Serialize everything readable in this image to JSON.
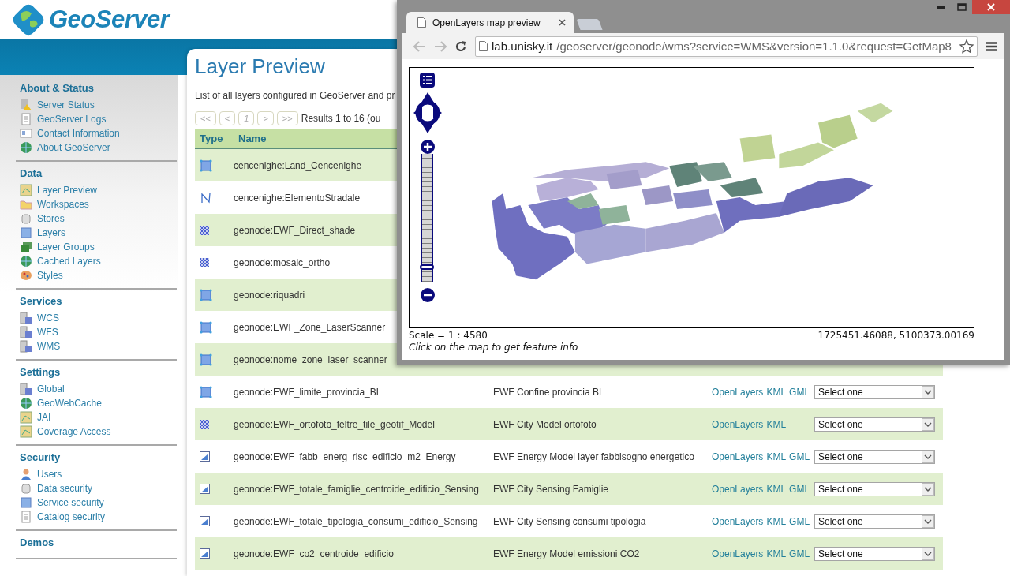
{
  "logo": {
    "text": "GeoServer"
  },
  "sidebar": {
    "sections": [
      {
        "title": "About & Status",
        "items": [
          "Server Status",
          "GeoServer Logs",
          "Contact Information",
          "About GeoServer"
        ]
      },
      {
        "title": "Data",
        "items": [
          "Layer Preview",
          "Workspaces",
          "Stores",
          "Layers",
          "Layer Groups",
          "Cached Layers",
          "Styles"
        ]
      },
      {
        "title": "Services",
        "items": [
          "WCS",
          "WFS",
          "WMS"
        ]
      },
      {
        "title": "Settings",
        "items": [
          "Global",
          "GeoWebCache",
          "JAI",
          "Coverage Access"
        ]
      },
      {
        "title": "Security",
        "items": [
          "Users",
          "Data security",
          "Service security",
          "Catalog security"
        ]
      },
      {
        "title": "Demos"
      }
    ]
  },
  "content": {
    "title": "Layer Preview",
    "description": "List of all layers configured in GeoServer and pr",
    "pager": {
      "buttons": [
        {
          "label": "<<",
          "kind": "nav"
        },
        {
          "label": "<",
          "kind": "nav"
        },
        {
          "label": "1",
          "kind": "page"
        },
        {
          "label": ">",
          "kind": "nav"
        },
        {
          "label": ">>",
          "kind": "nav"
        }
      ],
      "results": "Results 1 to 16 (ou"
    },
    "table": {
      "columns": [
        "Type",
        "Name"
      ],
      "rows": [
        {
          "kind": "polygon",
          "name": "cencenighe:Land_Cencenighe"
        },
        {
          "kind": "line",
          "name": "cencenighe:ElementoStradale"
        },
        {
          "kind": "raster",
          "name": "geonode:EWF_Direct_shade"
        },
        {
          "kind": "raster",
          "name": "geonode:mosaic_ortho"
        },
        {
          "kind": "polygon",
          "name": "geonode:riquadri"
        },
        {
          "kind": "polygon",
          "name": "geonode:EWF_Zone_LaserScanner"
        },
        {
          "kind": "polygon",
          "name": "geonode:nome_zone_laser_scanner"
        },
        {
          "kind": "polygon",
          "name": "geonode:EWF_limite_provincia_BL",
          "title": "EWF Confine provincia BL",
          "formats": [
            "OpenLayers",
            "KML",
            "GML"
          ],
          "select": "Select one"
        },
        {
          "kind": "raster",
          "name": "geonode:EWF_ortofoto_feltre_tile_geotif_Model",
          "title": "EWF City Model ortofoto",
          "formats": [
            "OpenLayers",
            "KML"
          ],
          "select": "Select one"
        },
        {
          "kind": "other",
          "name": "geonode:EWF_fabb_energ_risc_edificio_m2_Energy",
          "title": "EWF Energy Model layer fabbisogno energetico",
          "formats": [
            "OpenLayers",
            "KML",
            "GML"
          ],
          "select": "Select one"
        },
        {
          "kind": "other",
          "name": "geonode:EWF_totale_famiglie_centroide_edificio_Sensing",
          "title": "EWF City Sensing Famiglie",
          "formats": [
            "OpenLayers",
            "KML",
            "GML"
          ],
          "select": "Select one"
        },
        {
          "kind": "other",
          "name": "geonode:EWF_totale_tipologia_consumi_edificio_Sensing",
          "title": "EWF City Sensing consumi tipologia",
          "formats": [
            "OpenLayers",
            "KML",
            "GML"
          ],
          "select": "Select one"
        },
        {
          "kind": "other",
          "name": "geonode:EWF_co2_centroide_edificio",
          "title": "EWF Energy Model emissioni CO2",
          "formats": [
            "OpenLayers",
            "KML",
            "GML"
          ],
          "select": "Select one"
        }
      ]
    }
  },
  "popup": {
    "tab": {
      "title": "OpenLayers map preview"
    },
    "url": {
      "host": "lab.unisky.it",
      "path": "/geoserver/geonode/wms?service=WMS&version=1.1.0&request=GetMap8"
    },
    "map": {
      "zoom": {
        "level": 0.08
      },
      "scale": "Scale = 1 : 4580",
      "coordinates": "1725451.46088, 5100373.00169",
      "hint": "Click on the map to get feature info"
    }
  }
}
